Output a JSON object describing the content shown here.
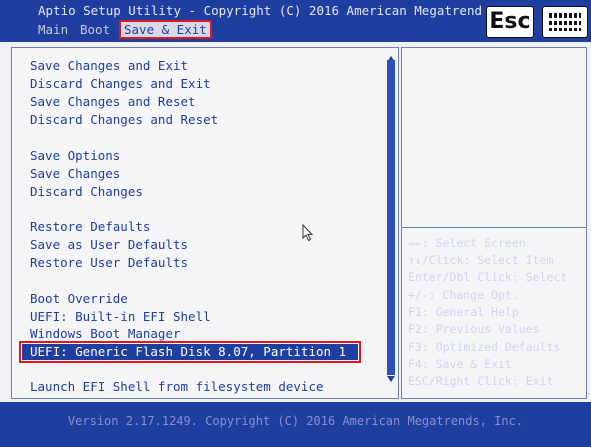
{
  "header": {
    "title": "Aptio Setup Utility - Copyright (C) 2016 American Megatrend",
    "tabs": [
      {
        "label": "Main",
        "active": false
      },
      {
        "label": "Boot",
        "active": false
      },
      {
        "label": "Save & Exit",
        "active": true
      }
    ],
    "esc_label": "Esc"
  },
  "menu": {
    "items": [
      "Save Changes and Exit",
      "Discard Changes and Exit",
      "Save Changes and Reset",
      "Discard Changes and Reset",
      "Save Options",
      "Save Changes",
      "Discard Changes",
      "Restore Defaults",
      "Save as User Defaults",
      "Restore User Defaults",
      "Boot Override",
      "UEFI: Built-in EFI Shell",
      "Windows Boot Manager",
      "UEFI: Generic Flash Disk 8.07, Partition 1",
      "Launch EFI Shell from filesystem device"
    ],
    "selected_index": 13
  },
  "help": [
    "→←: Select Screen",
    "↑↓/Click: Select Item",
    "Enter/Dbl Click: Select",
    "+/-: Change Opt.",
    "F1: General Help",
    "F2: Previous Values",
    "F3: Optimized Defaults",
    "F4: Save & Exit",
    "ESC/Right Click: Exit"
  ],
  "footer": {
    "version": "Version 2.17.1249. Copyright (C) 2016 American Megatrends, Inc."
  },
  "colors": {
    "bios_blue": "#1e3ea0",
    "selection_outline": "#e01818"
  }
}
